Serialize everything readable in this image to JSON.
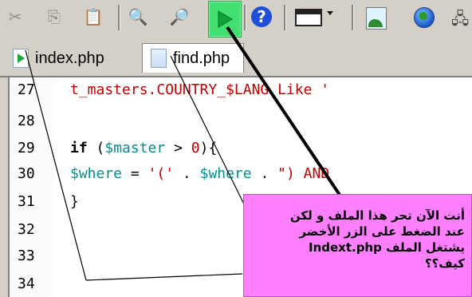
{
  "toolbar": {
    "items": [
      {
        "name": "cut",
        "glyph": "✂"
      },
      {
        "name": "copy",
        "glyph": "⎘"
      },
      {
        "name": "paste",
        "glyph": "📋"
      },
      {
        "name": "find",
        "glyph": "🔍"
      },
      {
        "name": "find-next",
        "glyph": "🔎"
      },
      {
        "name": "run",
        "glyph": "▶"
      },
      {
        "name": "help",
        "glyph": "?"
      },
      {
        "name": "window",
        "glyph": ""
      },
      {
        "name": "image",
        "glyph": ""
      },
      {
        "name": "browser",
        "glyph": ""
      },
      {
        "name": "network",
        "glyph": "🖧"
      }
    ],
    "run_color": "#42e070"
  },
  "tabs": [
    {
      "label": "index.php",
      "active": false
    },
    {
      "label": "find.php",
      "active": true
    }
  ],
  "editor": {
    "lines": [
      {
        "num": "27",
        "code": "t_masters.COUNTRY_$LANG Like '"
      },
      {
        "num": "28",
        "code": ""
      },
      {
        "num": "29",
        "code": "if ($master > 0){"
      },
      {
        "num": "30",
        "code": "$where = '(' . $where . \") AND"
      },
      {
        "num": "31",
        "code": "}"
      },
      {
        "num": "32",
        "code": ""
      },
      {
        "num": "33",
        "code": ""
      },
      {
        "num": "34",
        "code": ""
      }
    ]
  },
  "annotation": {
    "text": "أنت الآن تحر هذا الملف و لكن\nعند الضغط على الزر الأخضر\nيشتغل الملف Indext.php\nكيف؟؟",
    "background": "#ff80ff"
  }
}
